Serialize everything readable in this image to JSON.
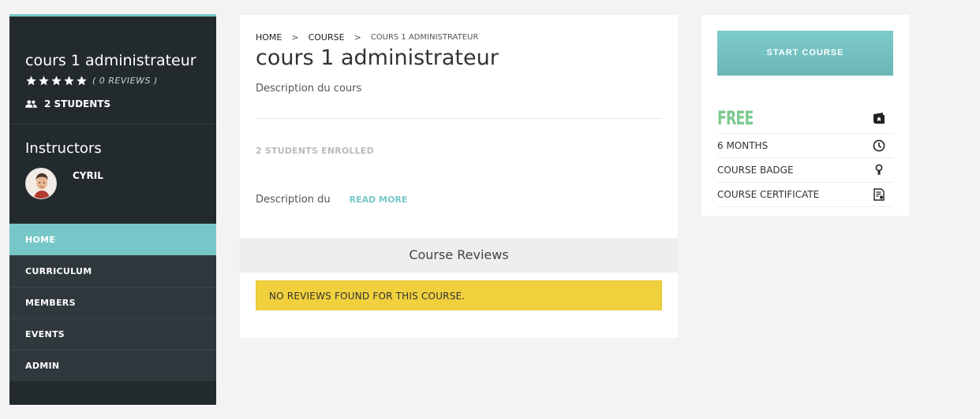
{
  "sidebar": {
    "course_title": "cours 1 administrateur",
    "rating_stars": 5,
    "reviews_label": "( 0 REVIEWS )",
    "students_label": "2 STUDENTS",
    "instructors_title": "Instructors",
    "instructor_name": "CYRIL",
    "nav": [
      {
        "label": "HOME",
        "active": true
      },
      {
        "label": "CURRICULUM",
        "active": false
      },
      {
        "label": "MEMBERS",
        "active": false
      },
      {
        "label": "EVENTS",
        "active": false
      },
      {
        "label": "ADMIN",
        "active": false
      }
    ]
  },
  "main": {
    "breadcrumb": [
      "HOME",
      "COURSE",
      "COURS 1 ADMINISTRATEUR"
    ],
    "title": "cours 1 administrateur",
    "description": "Description du cours",
    "enrolled": "2 STUDENTS ENROLLED",
    "excerpt": "Description du",
    "read_more": "READ MORE",
    "reviews_heading": "Course Reviews",
    "no_reviews": "NO REVIEWS FOUND FOR THIS COURSE."
  },
  "side": {
    "start_button": "START COURSE",
    "price": "FREE",
    "duration": "6 MONTHS",
    "badge": "COURSE BADGE",
    "certificate": "COURSE CERTIFICATE"
  },
  "colors": {
    "accent": "#78c7c8",
    "sidebar_bg": "#232a2d",
    "free_green": "#7dca8f",
    "notice_yellow": "#f1d03e"
  }
}
